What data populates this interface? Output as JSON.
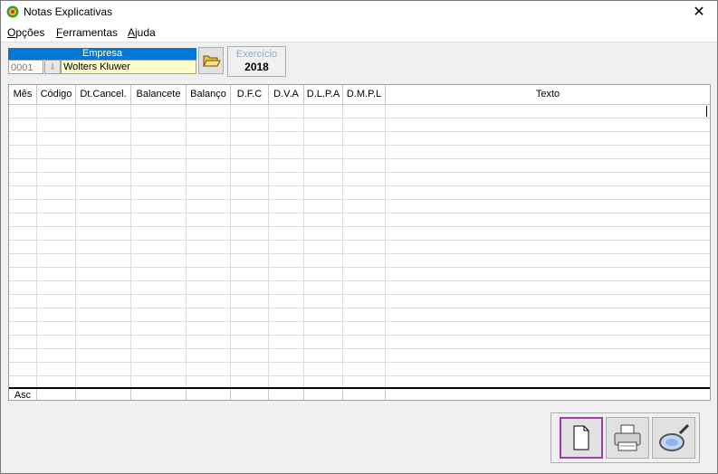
{
  "window": {
    "title": "Notas Explicativas",
    "close_glyph": "✕"
  },
  "menu": {
    "items": [
      {
        "mnemonic": "O",
        "rest": "pções"
      },
      {
        "mnemonic": "F",
        "rest": "erramentas"
      },
      {
        "mnemonic": "A",
        "rest": "juda"
      }
    ]
  },
  "empresa": {
    "label": "Empresa",
    "code": "0001",
    "name": "Wolters Kluwer"
  },
  "exercicio": {
    "label": "Exercício",
    "value": "2018"
  },
  "grid": {
    "columns": [
      "Mês",
      "Código",
      "Dt.Cancel.",
      "Balancete",
      "Balanço",
      "D.F.C",
      "D.V.A",
      "D.L.P.A",
      "D.M.P.L",
      "Texto"
    ],
    "footer_first": "Asc"
  },
  "toolbar": {
    "buttons": [
      {
        "icon": "new-document-icon",
        "selected": true
      },
      {
        "icon": "printer-icon",
        "selected": false
      },
      {
        "icon": "magnifier-icon",
        "selected": false
      }
    ]
  },
  "colors": {
    "accent": "#0078d7",
    "selection": "#9b3fa0",
    "empresa_name_bg": "#ffffcc"
  }
}
